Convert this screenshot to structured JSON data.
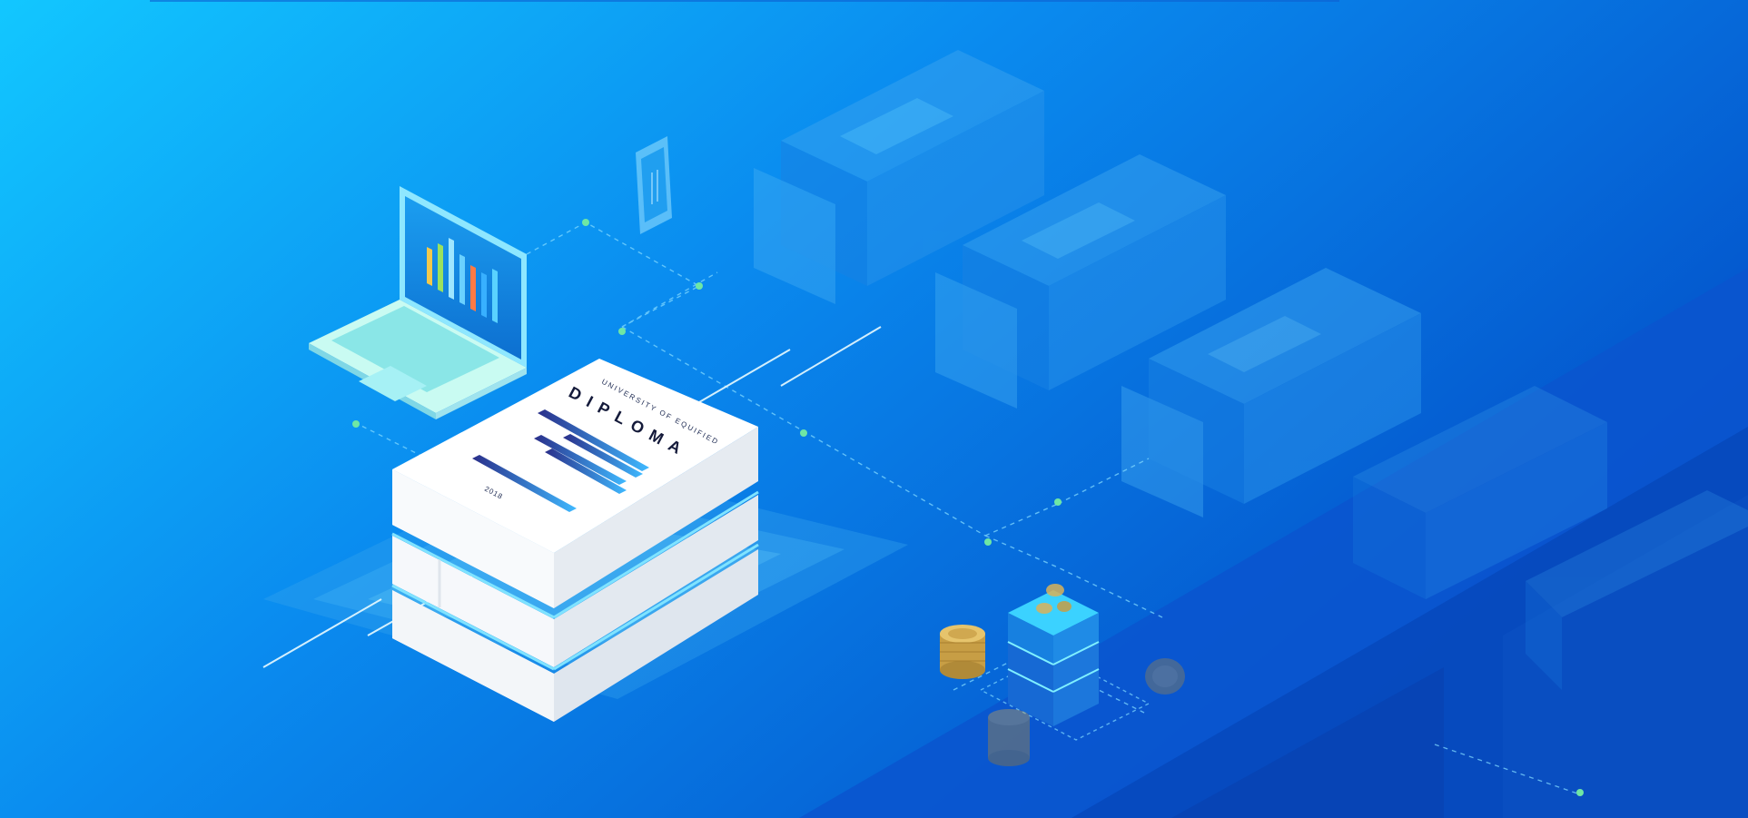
{
  "scene": {
    "diploma": {
      "university": "UNIVERSITY OF EQUIFIED",
      "title": "DIPLOMA",
      "year": "2018"
    }
  },
  "colors": {
    "background_start": "#12c7ff",
    "background_mid": "#0a8bef",
    "background_end": "#0350c9",
    "connector_dot": "#6fe7a4",
    "diploma_bar_start": "#2a2f8a",
    "diploma_bar_end": "#3fb9ff",
    "coin": "#d9b25a"
  },
  "icons": [
    "laptop-icon",
    "phone-icon",
    "server-block-icon",
    "bitcoin-coin-icon",
    "diploma-book-icon"
  ]
}
